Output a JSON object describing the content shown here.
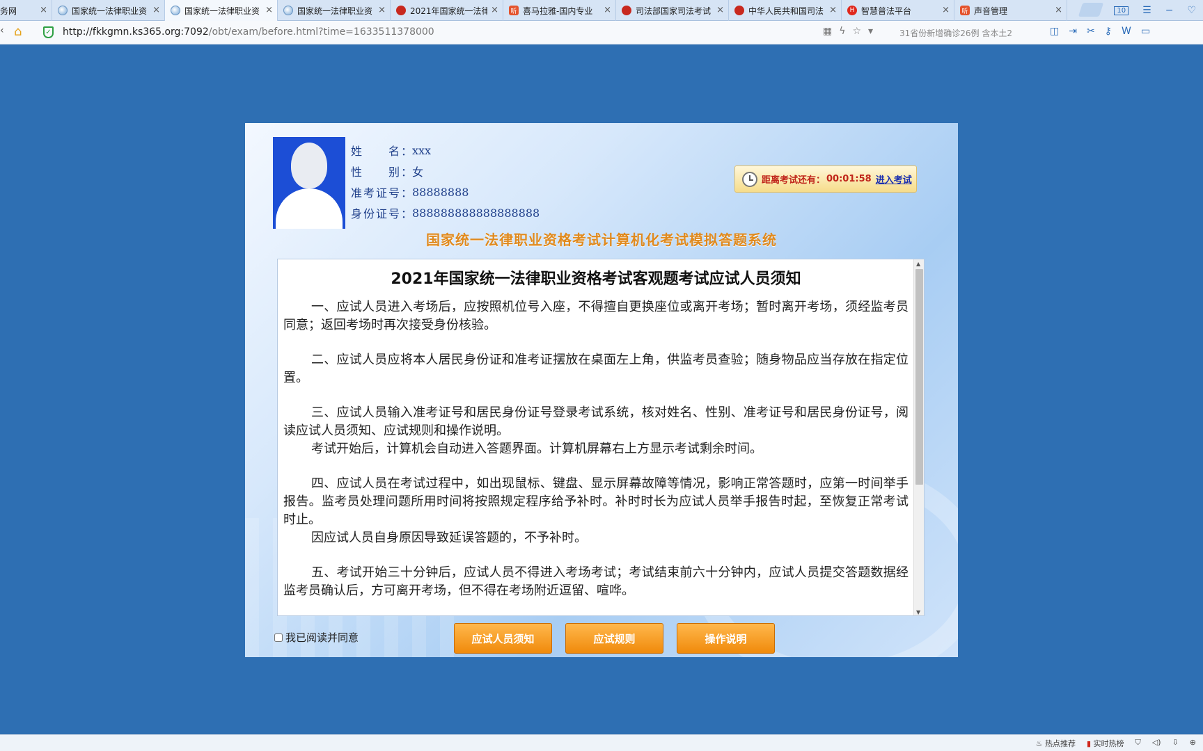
{
  "browser": {
    "tabs": [
      {
        "title": "务网",
        "icon": "none"
      },
      {
        "title": "国家统一法律职业资",
        "icon": "globe"
      },
      {
        "title": "国家统一法律职业资",
        "icon": "globe",
        "active": true
      },
      {
        "title": "国家统一法律职业资",
        "icon": "globe"
      },
      {
        "title": "2021年国家统一法律",
        "icon": "emblem"
      },
      {
        "title": "喜马拉雅-国内专业",
        "icon": "ximalaya"
      },
      {
        "title": "司法部国家司法考试",
        "icon": "emblem"
      },
      {
        "title": "中华人民共和国司法",
        "icon": "emblem"
      },
      {
        "title": "智慧普法平台",
        "icon": "hf"
      },
      {
        "title": "声音管理",
        "icon": "ximalaya"
      }
    ],
    "tab_close_glyph": "×",
    "tab_count": "10",
    "url_host": "http://fkkgmn.ks365.org:7092",
    "url_path": "/obt/exam/before.html?time=1633511378000",
    "search_hint": "31省份新增确诊26例 含本土2"
  },
  "candidate": {
    "name_label": "姓　　名：",
    "name": "xxx",
    "gender_label": "性　　别：",
    "gender": "女",
    "ticket_label": "准考证号：",
    "ticket": "88888888",
    "id_label": "身份证号：",
    "id": "888888888888888888"
  },
  "countdown": {
    "label": "距离考试还有：",
    "time": "00:01:58",
    "enter": "进入考试"
  },
  "system_title": "国家统一法律职业资格考试计算机化考试模拟答题系统",
  "notice": {
    "title": "2021年国家统一法律职业资格考试客观题考试应试人员须知",
    "paragraphs": [
      {
        "text": "一、应试人员进入考场后，应按照机位号入座，不得擅自更换座位或离开考场；暂时离开考场，须经监考员同意；返回考场时再次接受身份核验。",
        "gap": false
      },
      {
        "text": "二、应试人员应将本人居民身份证和准考证摆放在桌面左上角，供监考员查验；随身物品应当存放在指定位置。",
        "gap": true
      },
      {
        "text": "三、应试人员输入准考证号和居民身份证号登录考试系统，核对姓名、性别、准考证号和居民身份证号，阅读应试人员须知、应试规则和操作说明。",
        "gap": true
      },
      {
        "text": "考试开始后，计算机会自动进入答题界面。计算机屏幕右上方显示考试剩余时间。",
        "gap": false
      },
      {
        "text": "四、应试人员在考试过程中，如出现鼠标、键盘、显示屏幕故障等情况，影响正常答题时，应第一时间举手报告。监考员处理问题所用时间将按照规定程序给予补时。补时时长为应试人员举手报告时起，至恢复正常考试时止。",
        "gap": true
      },
      {
        "text": "因应试人员自身原因导致延误答题的，不予补时。",
        "gap": false
      },
      {
        "text": "五、考试开始三十分钟后，应试人员不得进入考场考试；考试结束前六十分钟内，应试人员提交答题数据经监考员确认后，方可离开考场，但不得在考场附近逗留、喧哗。",
        "gap": true
      }
    ]
  },
  "agree_label": "我已阅读并同意",
  "buttons": {
    "notice": "应试人员须知",
    "rules": "应试规则",
    "instructions": "操作说明"
  },
  "statusbar": {
    "hot": "热点推荐",
    "realtime": "实时热榜"
  },
  "colors": {
    "page_bg": "#2e6fb3",
    "button_orange": "#f08a0b",
    "title_orange": "#e08a1e",
    "countdown_red": "#c0251b"
  }
}
